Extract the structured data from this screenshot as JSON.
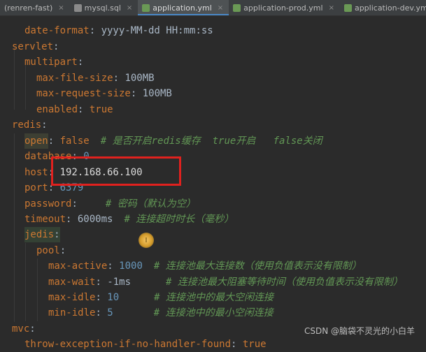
{
  "tabs": [
    {
      "label": "(renren-fast)",
      "active": false,
      "icon_color": "#6b8e23"
    },
    {
      "label": "mysql.sql",
      "active": false,
      "icon_color": "#8a8a8a"
    },
    {
      "label": "application.yml",
      "active": true,
      "icon_color": "#6a9955"
    },
    {
      "label": "application-prod.yml",
      "active": false,
      "icon_color": "#6a9955"
    },
    {
      "label": "application-dev.yml",
      "active": false,
      "icon_color": "#6a9955"
    }
  ],
  "tab_close_glyph": "×",
  "code": {
    "l1": {
      "key": "date-format",
      "sep": ": ",
      "val": "yyyy-MM-dd HH:mm:ss"
    },
    "l2": {
      "key": "servlet",
      "sep": ":"
    },
    "l3": {
      "key": "multipart",
      "sep": ":"
    },
    "l4": {
      "key": "max-file-size",
      "sep": ": ",
      "val": "100MB"
    },
    "l5": {
      "key": "max-request-size",
      "sep": ": ",
      "val": "100MB"
    },
    "l6": {
      "key": "enabled",
      "sep": ": ",
      "val": "true"
    },
    "l7": {
      "key": "redis",
      "sep": ":"
    },
    "l8": {
      "key": "open",
      "sep": ": ",
      "val": "false",
      "comment": "# 是否开启redis缓存  true开启   false关闭"
    },
    "l9": {
      "key": "database",
      "sep": ": ",
      "val": "0"
    },
    "l10": {
      "key": "host",
      "sep": ": ",
      "val": "192.168.66.100"
    },
    "l11": {
      "key": "port",
      "sep": ": ",
      "val": "6379"
    },
    "l12": {
      "key": "password",
      "sep": ":",
      "comment": "# 密码（默认为空）"
    },
    "l13": {
      "key": "timeout",
      "sep": ": ",
      "val": "6000ms",
      "comment": "# 连接超时时长（毫秒）"
    },
    "l14": {
      "key": "jedis",
      "sep": ":"
    },
    "l15": {
      "key": "pool",
      "sep": ":"
    },
    "l16": {
      "key": "max-active",
      "sep": ": ",
      "val": "1000",
      "comment": "# 连接池最大连接数（使用负值表示没有限制）"
    },
    "l17": {
      "key": "max-wait",
      "sep": ": ",
      "val": "-1ms",
      "comment": "# 连接池最大阻塞等待时间（使用负值表示没有限制）"
    },
    "l18": {
      "key": "max-idle",
      "sep": ": ",
      "val": "10",
      "comment": "# 连接池中的最大空闲连接"
    },
    "l19": {
      "key": "min-idle",
      "sep": ": ",
      "val": "5",
      "comment": "# 连接池中的最小空闲连接"
    },
    "l20": {
      "key": "mvc",
      "sep": ":"
    },
    "l21": {
      "key": "throw-exception-if-no-handler-found",
      "sep": ": ",
      "val": "true"
    }
  },
  "cursor_glyph": "I",
  "watermark": "CSDN @脑袋不灵光的小白羊"
}
